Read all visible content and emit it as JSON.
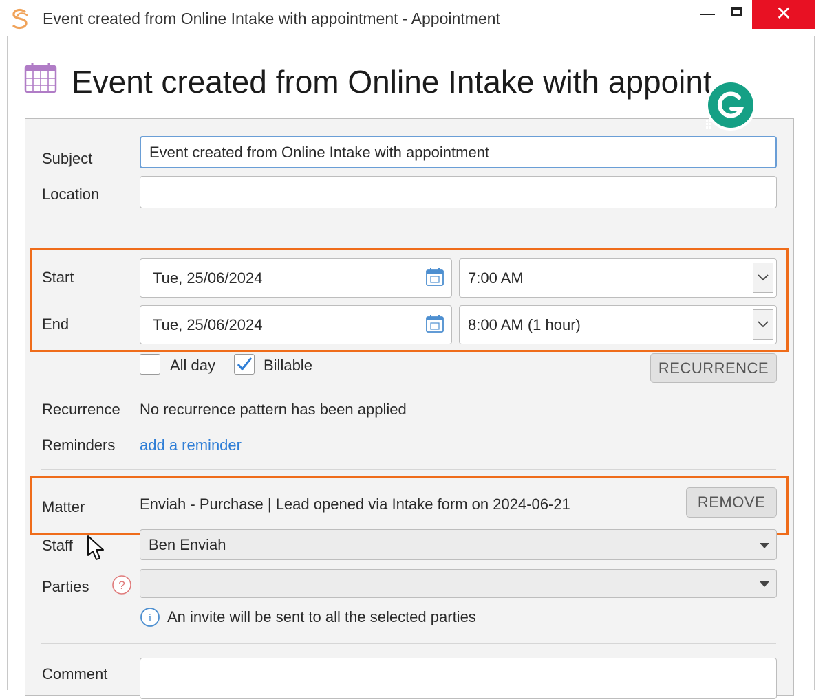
{
  "window": {
    "title": "Event created from Online Intake with appointment - Appointment",
    "close_glyph": "✕"
  },
  "header": {
    "title": "Event created from Online Intake with appointment"
  },
  "form": {
    "subject": {
      "label": "Subject",
      "value": "Event created from Online Intake with appointment"
    },
    "location": {
      "label": "Location",
      "value": ""
    },
    "start": {
      "label": "Start",
      "date": "Tue, 25/06/2024",
      "time": "7:00 AM"
    },
    "end": {
      "label": "End",
      "date": "Tue, 25/06/2024",
      "time": "8:00 AM (1 hour)"
    },
    "all_day": {
      "label": "All day",
      "checked": false
    },
    "billable": {
      "label": "Billable",
      "checked": true
    },
    "recurrence_button": "RECURRENCE",
    "recurrence": {
      "label": "Recurrence",
      "value": "No recurrence pattern has been applied"
    },
    "reminders": {
      "label": "Reminders",
      "link": "add a reminder"
    },
    "matter": {
      "label": "Matter",
      "value": "Enviah - Purchase | Lead opened via Intake form on 2024-06-21",
      "remove_button": "REMOVE"
    },
    "staff": {
      "label": "Staff",
      "value": "Ben Enviah"
    },
    "parties": {
      "label": "Parties",
      "value": "",
      "help_glyph": "?"
    },
    "invite_note": {
      "glyph": "i",
      "text": "An invite will be sent to all the selected parties"
    },
    "comment": {
      "label": "Comment",
      "value": ""
    }
  },
  "colors": {
    "highlight": "#ef6c1a",
    "link": "#2f7ed6",
    "close": "#e81123",
    "accent_icon": "#b07cc6"
  },
  "icons": {
    "app": "app-logo-icon",
    "calendar": "calendar-icon",
    "date_picker": "date-picker-icon",
    "dropdown": "chevron-down-icon",
    "help": "help-icon",
    "info": "info-icon",
    "assistant": "grammarly-icon"
  }
}
